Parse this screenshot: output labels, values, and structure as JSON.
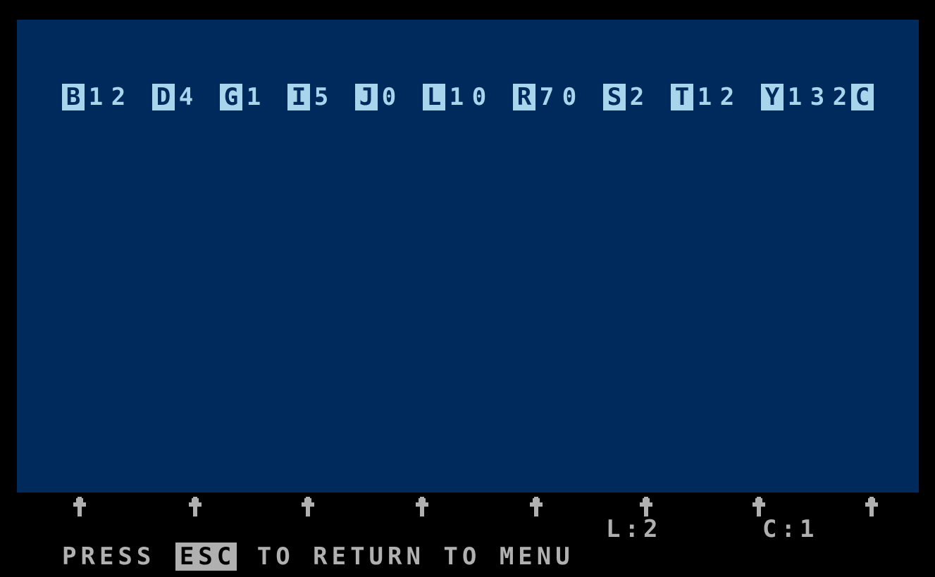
{
  "screen": {
    "title": "Text Editor Ruler / Format Settings Screen",
    "background_color": "#000000",
    "document_color": "#002A5C",
    "ruler_text_color": "#A8D4EC",
    "status_text_color": "#B0B0B0"
  },
  "ruler": {
    "name": "format-settings-ruler",
    "raw_text": "B12 D4 G1 I5 J0 L10 R70 S2 T12 Y132C",
    "settings": [
      {
        "key": "B",
        "value": "12",
        "label": "B12"
      },
      {
        "key": "D",
        "value": "4",
        "label": "D4"
      },
      {
        "key": "G",
        "value": "1",
        "label": "G1"
      },
      {
        "key": "I",
        "value": "5",
        "label": "I5"
      },
      {
        "key": "J",
        "value": "0",
        "label": "J0"
      },
      {
        "key": "L",
        "value": "10",
        "label": "L10"
      },
      {
        "key": "R",
        "value": "70",
        "label": "R70"
      },
      {
        "key": "S",
        "value": "2",
        "label": "S2"
      },
      {
        "key": "T",
        "value": "12",
        "label": "T12"
      },
      {
        "key": "Y",
        "value": "132",
        "label": "Y132"
      }
    ],
    "cursor_char": "C"
  },
  "document": {
    "name": "document-body",
    "content": ""
  },
  "tabstops": {
    "name": "tab-stop-ruler",
    "icon": "up-arrow-icon",
    "count": 8,
    "positions": [
      100,
      264,
      424,
      586,
      748,
      904,
      1064,
      1224
    ]
  },
  "status": {
    "line_label": "L:2",
    "line_number": "2",
    "column_label": "C:1",
    "column_number": "1"
  },
  "prompt": {
    "before": "PRESS ",
    "key": "ESC",
    "after": " TO RETURN TO MENU",
    "full": "PRESS ESC TO RETURN TO MENU"
  }
}
